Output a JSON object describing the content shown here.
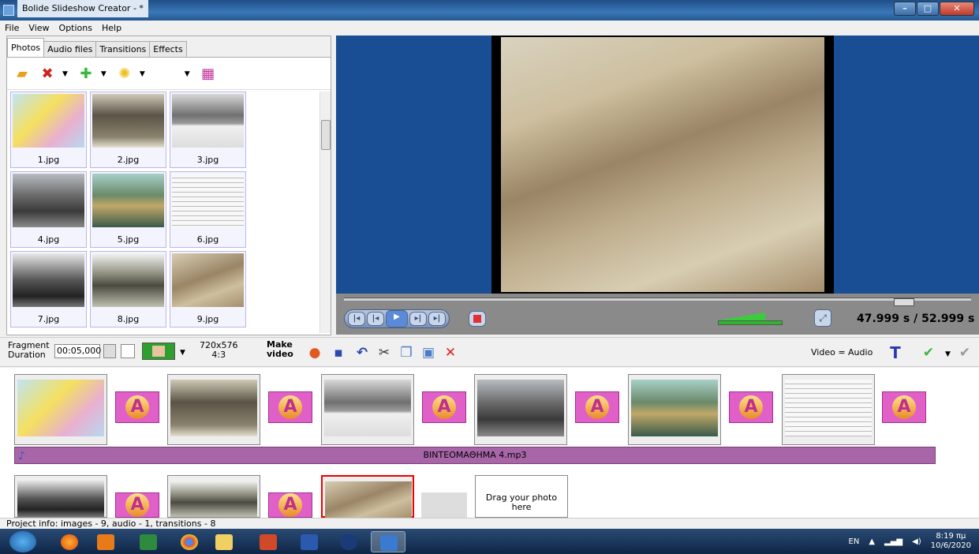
{
  "window": {
    "title": "Bolide Slideshow Creator - *"
  },
  "menu": [
    "File",
    "View",
    "Options",
    "Help"
  ],
  "tabs": [
    "Photos",
    "Audio files",
    "Transitions",
    "Effects"
  ],
  "toolbar": {
    "icons": [
      "open-folder-icon",
      "delete-icon",
      "add-icon",
      "effects-icon",
      "film-icon"
    ]
  },
  "photos": [
    {
      "name": "1.jpg"
    },
    {
      "name": "2.jpg"
    },
    {
      "name": "3.jpg"
    },
    {
      "name": "4.jpg"
    },
    {
      "name": "5.jpg"
    },
    {
      "name": "6.jpg"
    },
    {
      "name": "7.jpg"
    },
    {
      "name": "8.jpg"
    },
    {
      "name": "9.jpg"
    }
  ],
  "player": {
    "current_time": "47.999 s",
    "total_time": "/ 52.999 s",
    "position": 0.906
  },
  "fragment": {
    "label": "Fragment",
    "label2": "Duration",
    "value": "00:05,000"
  },
  "resolution": {
    "size": "720x576",
    "ratio": "4:3"
  },
  "make_video": {
    "line1": "Make",
    "line2": "video"
  },
  "video_audio": "Video = Audio",
  "audio_track": {
    "name": "ΒΙΝΤΕΟΜΑΘΗΜΑ 4.mp3"
  },
  "drag_box": {
    "line1": "Drag your photo",
    "line2": "here"
  },
  "transition_letter": "A",
  "status": "Project info: images - 9, audio - 1, transitions - 8",
  "tray": {
    "lang": "EN",
    "time": "8:19 πμ",
    "date": "10/6/2020"
  }
}
